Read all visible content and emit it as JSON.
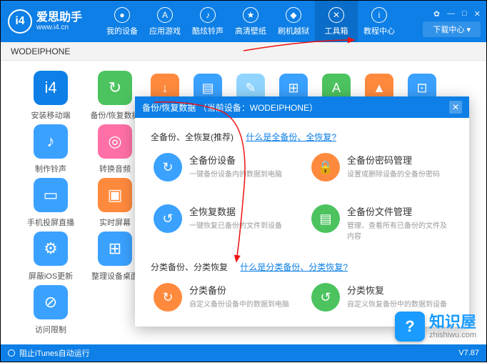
{
  "header": {
    "logo_glyph": "i4",
    "title": "爱思助手",
    "url": "www.i4.cn",
    "nav": [
      {
        "label": "我的设备",
        "icon": "●"
      },
      {
        "label": "应用游戏",
        "icon": "A"
      },
      {
        "label": "酷炫铃声",
        "icon": "♪"
      },
      {
        "label": "高清壁纸",
        "icon": "★"
      },
      {
        "label": "刷机越狱",
        "icon": "◆"
      },
      {
        "label": "工具箱",
        "icon": "✕"
      },
      {
        "label": "教程中心",
        "icon": "i"
      }
    ],
    "active_nav": 5,
    "download_btn": "下载中心 ▾",
    "win": {
      "settings": "✿",
      "min": "—",
      "max": "□",
      "close": "✕"
    }
  },
  "subbar": {
    "device": "WODEIPHONE"
  },
  "tiles_col1": [
    {
      "label": "安装移动端",
      "bg": "#0d7fe6",
      "glyph": "i4"
    },
    {
      "label": "制作铃声",
      "bg": "#3aa1ff",
      "glyph": "♪"
    },
    {
      "label": "手机投屏直播",
      "bg": "#3aa1ff",
      "glyph": "▭"
    },
    {
      "label": "屏蔽iOS更新",
      "bg": "#3aa1ff",
      "glyph": "⚙"
    },
    {
      "label": "访问限制",
      "bg": "#3aa1ff",
      "glyph": "⊘"
    }
  ],
  "tiles_col2": [
    {
      "label": "备份/恢复数据",
      "bg": "#4cc35f",
      "glyph": "↻"
    },
    {
      "label": "转换音频",
      "bg": "#ff70a6",
      "glyph": "◎"
    },
    {
      "label": "实时屏幕",
      "bg": "#ff8a3d",
      "glyph": "▣"
    },
    {
      "label": "整理设备桌面",
      "bg": "#3aa1ff",
      "glyph": "⊞"
    }
  ],
  "row_minis": [
    {
      "bg": "#ff8a3d",
      "glyph": "↓"
    },
    {
      "bg": "#3aa1ff",
      "glyph": "▤"
    },
    {
      "bg": "#91d5ff",
      "glyph": "✎"
    },
    {
      "bg": "#3aa1ff",
      "glyph": "⊞"
    },
    {
      "bg": "#4cc35f",
      "glyph": "A"
    },
    {
      "bg": "#ff8a3d",
      "glyph": "▲"
    },
    {
      "bg": "#3aa1ff",
      "glyph": "⊡"
    }
  ],
  "modal": {
    "title_prefix": "备份/恢复数据",
    "title_device": "（当前设备：WODEIPHONE）",
    "section1": {
      "header": "全备份、全恢复(推荐)",
      "link": "什么是全备份、全恢复?",
      "opts": [
        {
          "title": "全备份设备",
          "sub": "一键备份设备内的数据到电脑",
          "bg": "#3aa1ff",
          "glyph": "↻"
        },
        {
          "title": "全备份密码管理",
          "sub": "设置或删除设备的全备份密码",
          "bg": "#ff8a3d",
          "glyph": "🔒"
        },
        {
          "title": "全恢复数据",
          "sub": "一键恢复已备份的文件到设备",
          "bg": "#3aa1ff",
          "glyph": "↺"
        },
        {
          "title": "全备份文件管理",
          "sub": "管理、查看所有已备份的文件及内容",
          "bg": "#4cc35f",
          "glyph": "▤"
        }
      ]
    },
    "section2": {
      "header": "分类备份、分类恢复",
      "link": "什么是分类备份、分类恢复?",
      "opts": [
        {
          "title": "分类备份",
          "sub": "自定义备份设备中的数据到电脑",
          "bg": "#ff8a3d",
          "glyph": "↻"
        },
        {
          "title": "分类恢复",
          "sub": "自定义恢复备份中的数据到设备",
          "bg": "#4cc35f",
          "glyph": "↺"
        }
      ]
    }
  },
  "status": {
    "left": "阻止iTunes自动运行",
    "version": "V7.87"
  },
  "watermark": {
    "glyph": "?",
    "title": "知识屋",
    "url": "zhishiwu.com"
  }
}
